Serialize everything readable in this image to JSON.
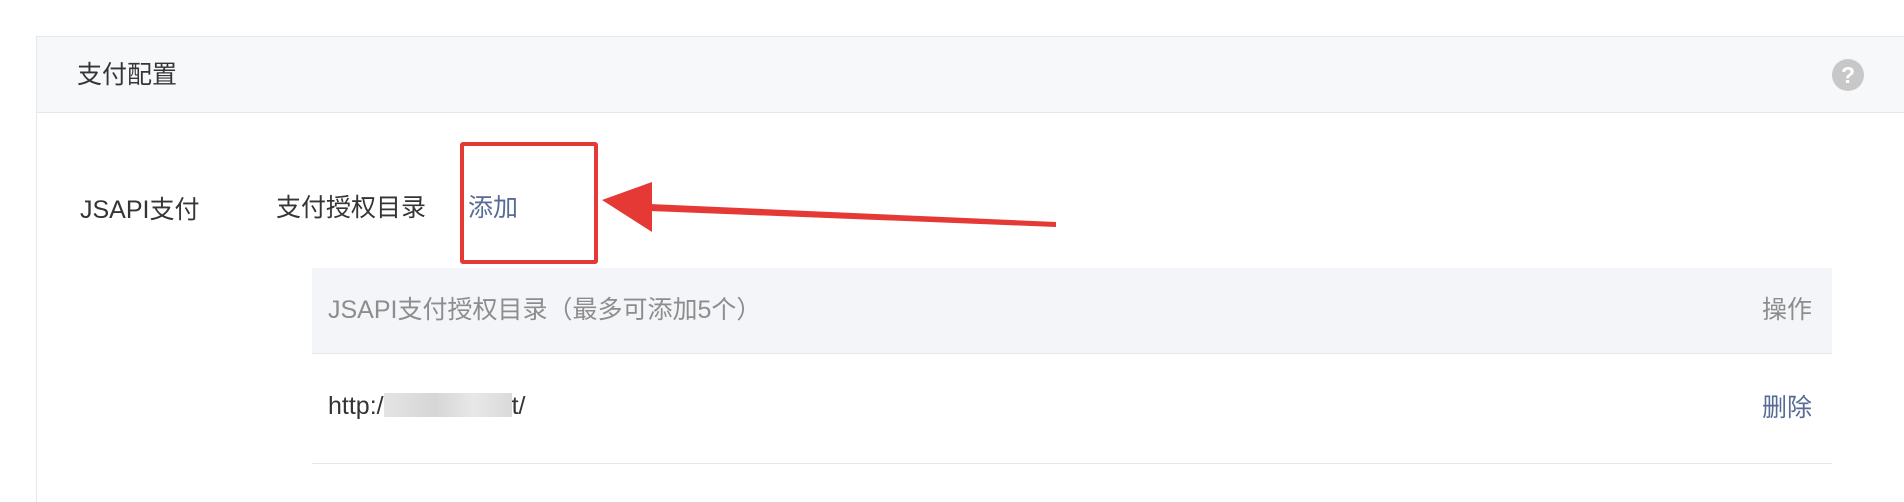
{
  "panel": {
    "title": "支付配置",
    "help_icon": "question-circle-icon"
  },
  "jsapi": {
    "label": "JSAPI支付",
    "directory_title": "支付授权目录",
    "add_label": "添加"
  },
  "table": {
    "header_main": "JSAPI支付授权目录（最多可添加5个）",
    "header_op": "操作",
    "rows": [
      {
        "url_prefix": "http:/",
        "url_suffix": "t/",
        "delete_label": "删除"
      }
    ]
  },
  "colors": {
    "link": "#576b95",
    "annotation": "#e53935",
    "header_bg": "#f7f8fa"
  }
}
